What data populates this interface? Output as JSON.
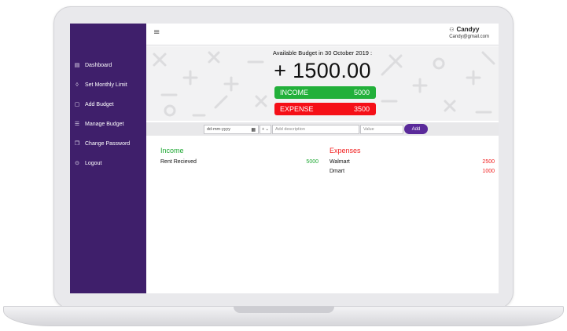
{
  "sidebar": {
    "items": [
      {
        "label": "Dashboard",
        "icon": "dashboard-icon",
        "glyph": "▤"
      },
      {
        "label": "Set Monthly Limit",
        "icon": "bell-icon",
        "glyph": "◊"
      },
      {
        "label": "Add Budget",
        "icon": "calendar-icon",
        "glyph": "▢"
      },
      {
        "label": "Manage Budget",
        "icon": "list-icon",
        "glyph": "☰"
      },
      {
        "label": "Change Password",
        "icon": "copy-icon",
        "glyph": "❐"
      },
      {
        "label": "Logout",
        "icon": "logout-icon",
        "glyph": "⊙"
      }
    ]
  },
  "topbar": {
    "menu_icon": "≡",
    "user_icon": "⚇",
    "username": "Candyy",
    "email": "Candy@gmail.com"
  },
  "budget": {
    "heading": "Available Budget in 30 October 2019 :",
    "amount": "+ 1500.00",
    "income_label": "INCOME",
    "income_value": "5000",
    "expense_label": "EXPENSE",
    "expense_value": "3500"
  },
  "form": {
    "date_placeholder": "dd-mm-yyyy",
    "calendar_glyph": "▦",
    "type_value": "+",
    "type_caret": "⌄",
    "description_placeholder": "Add description",
    "value_placeholder": "Value",
    "add_label": "Add"
  },
  "income": {
    "title": "Income",
    "items": [
      {
        "name": "Rent Recieved",
        "amount": "5000"
      }
    ]
  },
  "expenses": {
    "title": "Expenses",
    "items": [
      {
        "name": "Walmart",
        "amount": "2500"
      },
      {
        "name": "Dmart",
        "amount": "1000"
      }
    ]
  },
  "colors": {
    "sidebar": "#3f1f6b",
    "income": "#22b03a",
    "expense": "#f50f17",
    "add_button": "#5a2a9a"
  }
}
